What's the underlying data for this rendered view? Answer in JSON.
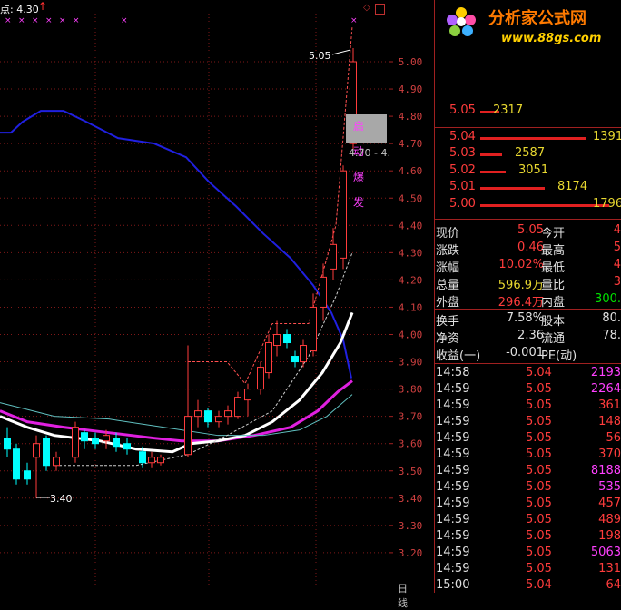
{
  "header": {
    "label": "点: 4.30"
  },
  "price_axis": {
    "ticks": [
      "5.00",
      "4.90",
      "4.80",
      "4.70",
      "4.60",
      "4.50",
      "4.40",
      "4.30",
      "4.20",
      "4.10",
      "4.00",
      "3.90",
      "3.80",
      "3.70",
      "3.60",
      "3.50",
      "3.40",
      "3.30",
      "3.20"
    ]
  },
  "annotations": {
    "high": "5.05",
    "low": "3.40",
    "range": "4.70 - 4.",
    "signal_chars": [
      "启",
      "动",
      "爆",
      "发"
    ]
  },
  "bottom": {
    "tab_label": "日线"
  },
  "logo": {
    "title": "分析家公式网",
    "url": "www.88gs.com"
  },
  "order_book": [
    {
      "price": "5.05",
      "volume": "2317",
      "bar": 0.15
    },
    {
      "price": "5.04",
      "volume": "13915",
      "bar": 0.82
    },
    {
      "price": "5.03",
      "volume": "2587",
      "bar": 0.17
    },
    {
      "price": "5.02",
      "volume": "3051",
      "bar": 0.2
    },
    {
      "price": "5.01",
      "volume": "8174",
      "bar": 0.5
    },
    {
      "price": "5.00",
      "volume": "1796",
      "bar": 1.0
    }
  ],
  "stats": [
    {
      "l1": "现价",
      "v1": "5.05",
      "c1": "red",
      "l2": "今开",
      "v2": "4"
    },
    {
      "l1": "涨跌",
      "v1": "0.46",
      "c1": "red",
      "l2": "最高",
      "v2": "5"
    },
    {
      "l1": "涨幅",
      "v1": "10.02%",
      "c1": "red",
      "l2": "最低",
      "v2": "4"
    },
    {
      "l1": "总量",
      "v1": "596.9万",
      "c1": "yellow",
      "l2": "量比",
      "v2": "3"
    },
    {
      "l1": "外盘",
      "v1": "296.4万",
      "c1": "red",
      "l2": "内盘",
      "v2": "300."
    }
  ],
  "stats2": [
    {
      "l1": "换手",
      "v1": "7.58%",
      "l2": "股本",
      "v2": "80."
    },
    {
      "l1": "净资",
      "v1": "2.36",
      "l2": "流通",
      "v2": "78."
    },
    {
      "l1": "收益(一)",
      "v1": "-0.001",
      "l2": "PE(动)",
      "v2": ""
    }
  ],
  "trades": [
    {
      "time": "14:58",
      "price": "5.04",
      "vol": "2193",
      "color": "magenta"
    },
    {
      "time": "14:59",
      "price": "5.05",
      "vol": "2264",
      "color": "magenta"
    },
    {
      "time": "14:59",
      "price": "5.05",
      "vol": "361",
      "color": "red"
    },
    {
      "time": "14:59",
      "price": "5.05",
      "vol": "148",
      "color": "red"
    },
    {
      "time": "14:59",
      "price": "5.05",
      "vol": "56",
      "color": "red"
    },
    {
      "time": "14:59",
      "price": "5.05",
      "vol": "370",
      "color": "red"
    },
    {
      "time": "14:59",
      "price": "5.05",
      "vol": "8188",
      "color": "magenta"
    },
    {
      "time": "14:59",
      "price": "5.05",
      "vol": "535",
      "color": "magenta"
    },
    {
      "time": "14:59",
      "price": "5.05",
      "vol": "457",
      "color": "red"
    },
    {
      "time": "14:59",
      "price": "5.05",
      "vol": "489",
      "color": "red"
    },
    {
      "time": "14:59",
      "price": "5.05",
      "vol": "198",
      "color": "red"
    },
    {
      "time": "14:59",
      "price": "5.05",
      "vol": "5063",
      "color": "magenta"
    },
    {
      "time": "14:59",
      "price": "5.05",
      "vol": "131",
      "color": "red"
    },
    {
      "time": "15:00",
      "price": "5.04",
      "vol": "64",
      "color": "red"
    }
  ],
  "colors": {
    "up": "#ff3c3c",
    "down": "#00ffff",
    "ma_blue": "#2020e0",
    "ma_white": "#ffffff",
    "ma_magenta": "#e020e0",
    "ma_cyan": "#60c0c0",
    "grid": "#a02020"
  }
}
